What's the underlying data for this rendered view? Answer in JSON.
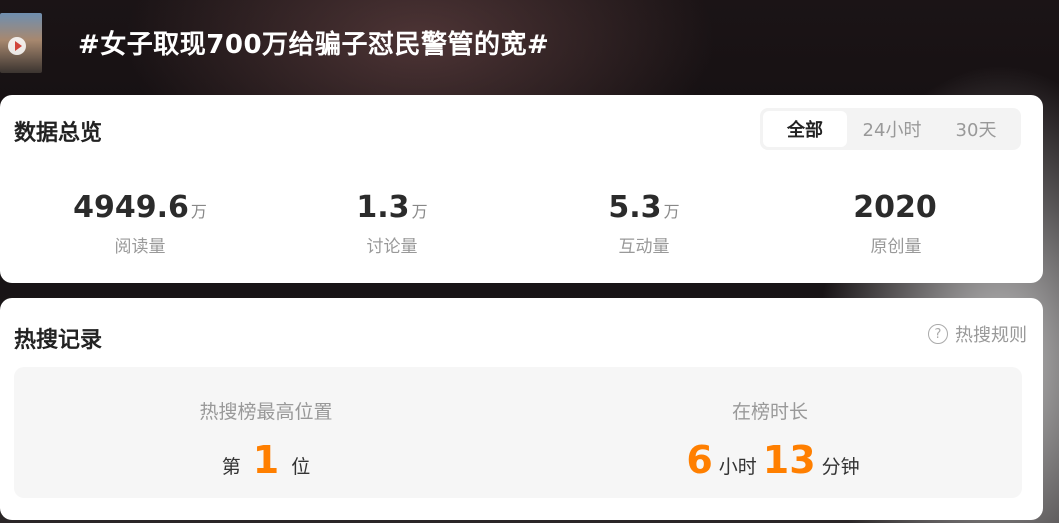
{
  "header": {
    "title": "#女子取现700万给骗子怼民警管的宽#"
  },
  "overview": {
    "title": "数据总览",
    "tabs": [
      "全部",
      "24小时",
      "30天"
    ],
    "selected_tab": "全部",
    "stats": [
      {
        "value": "4949.6",
        "unit": "万",
        "label": "阅读量"
      },
      {
        "value": "1.3",
        "unit": "万",
        "label": "讨论量"
      },
      {
        "value": "5.3",
        "unit": "万",
        "label": "互动量"
      },
      {
        "value": "2020",
        "unit": "",
        "label": "原创量"
      }
    ]
  },
  "records": {
    "title": "热搜记录",
    "rules_label": "热搜规则",
    "peak": {
      "label": "热搜榜最高位置",
      "prefix": "第",
      "value": "1",
      "suffix": "位"
    },
    "duration": {
      "label": "在榜时长",
      "hours": "6",
      "hours_unit": "小时",
      "minutes": "13",
      "minutes_unit": "分钟"
    }
  },
  "colors": {
    "accent": "#ff7f00"
  }
}
